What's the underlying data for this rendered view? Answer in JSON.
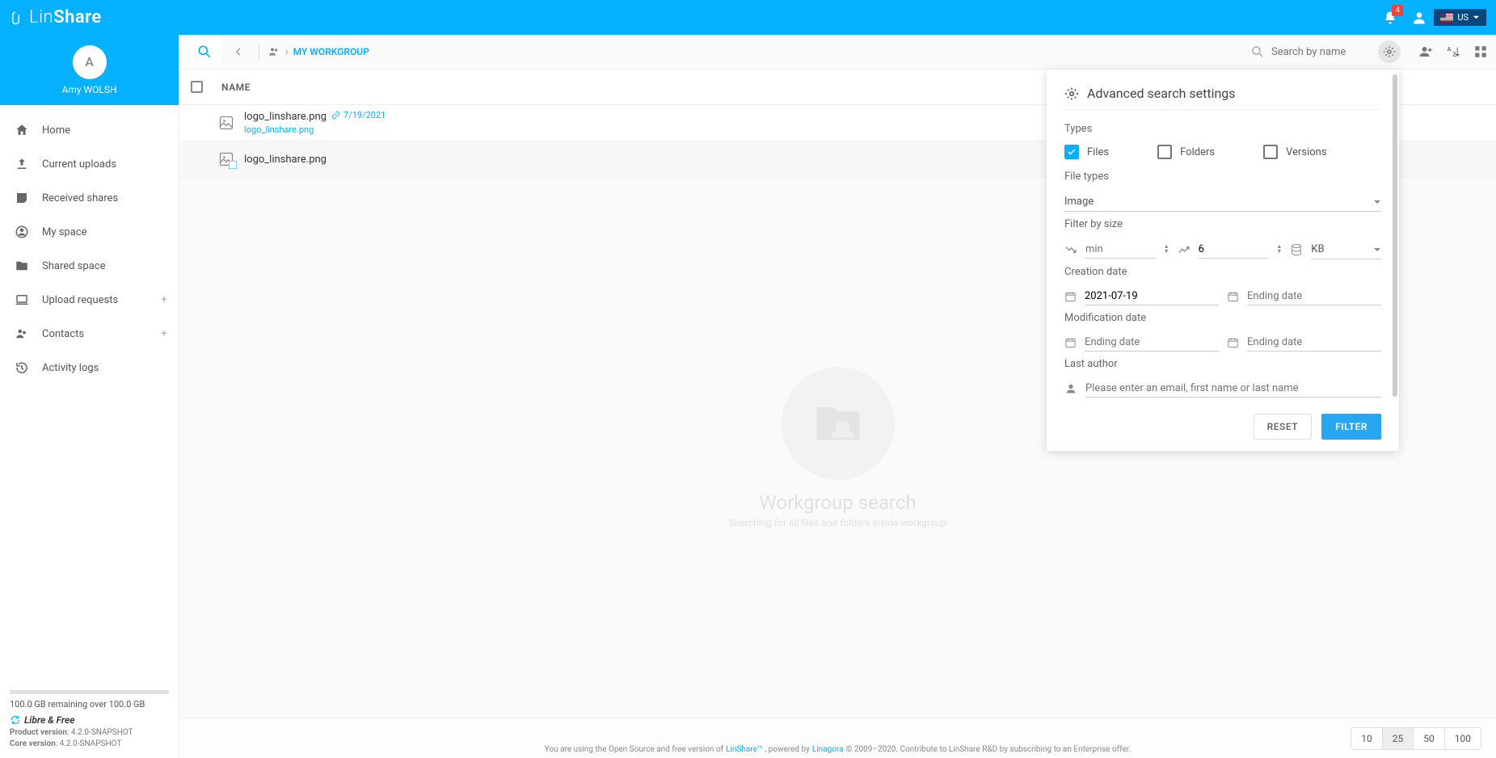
{
  "topbar": {
    "brand_a": "Lin",
    "brand_b": "Share",
    "notif_count": "4",
    "lang_label": "US"
  },
  "profile": {
    "initial": "A",
    "name": "Amy WOLSH"
  },
  "nav": {
    "home": "Home",
    "current_uploads": "Current uploads",
    "received_shares": "Received shares",
    "my_space": "My space",
    "shared_space": "Shared space",
    "upload_requests": "Upload requests",
    "contacts": "Contacts",
    "activity_logs": "Activity logs"
  },
  "toolbar": {
    "breadcrumb_label": "MY WORKGROUP",
    "search_placeholder": "Search by name"
  },
  "table": {
    "header_name": "NAME",
    "rows": [
      {
        "name": "logo_linshare.png",
        "link_date": "7/19/2021",
        "sub": "logo_linshare.png"
      },
      {
        "name": "logo_linshare.png"
      }
    ]
  },
  "empty": {
    "title": "Workgroup search",
    "sub": "Searching for all files and folders inside workgroup"
  },
  "advanced": {
    "title": "Advanced search settings",
    "types_label": "Types",
    "check_files": "Files",
    "check_folders": "Folders",
    "check_versions": "Versions",
    "file_types_label": "File types",
    "file_types_value": "Image",
    "filter_size_label": "Filter by size",
    "min_placeholder": "min",
    "max_value": "6",
    "unit_value": "KB",
    "creation_label": "Creation date",
    "creation_from": "2021-07-19",
    "creation_to": "Ending date",
    "modification_label": "Modification date",
    "mod_from": "Ending date",
    "mod_to": "Ending date",
    "author_label": "Last author",
    "author_placeholder": "Please enter an email, first name or last name",
    "reset_btn": "RESET",
    "filter_btn": "FILTER"
  },
  "pagination": {
    "p10": "10",
    "p25": "25",
    "p50": "50",
    "p100": "100"
  },
  "quota": {
    "text": "100.0 GB remaining over 100.0 GB",
    "libre": "Libre & Free",
    "product_label": "Product version",
    "product_val": ": 4.2.0-SNAPSHOT",
    "core_label": "Core version",
    "core_val": ": 4.2.0-SNAPSHOT"
  },
  "footer": {
    "a": "You are using the Open Source and free version of ",
    "link1": "LinShare™",
    "b": ", powered by ",
    "link2": "Linagora",
    "c": " © 2009–2020. Contribute to LinShare R&D by subscribing to an Enterprise offer."
  }
}
